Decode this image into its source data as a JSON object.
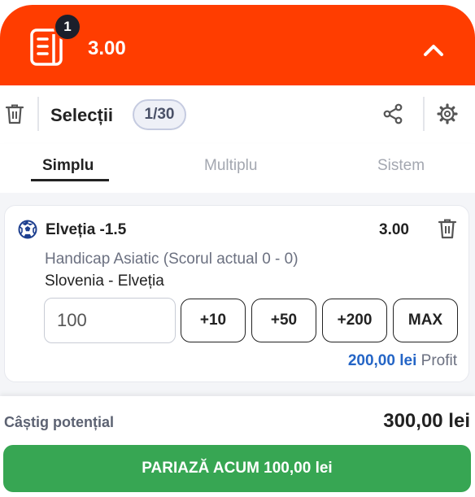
{
  "header": {
    "badge_count": "1",
    "total_odds": "3.00",
    "colors": {
      "background": "#ff3d00",
      "badge": "#1c1f2b"
    },
    "icons": {
      "betslip": "betslip-icon",
      "collapse": "chevron-up-icon"
    }
  },
  "toolbar": {
    "title": "Selecții",
    "count": "1/30",
    "icons": {
      "delete_all": "trash-icon",
      "share": "share-icon",
      "settings": "gear-icon"
    }
  },
  "tabs": [
    {
      "label": "Simplu",
      "active": true
    },
    {
      "label": "Multiplu",
      "active": false
    },
    {
      "label": "Sistem",
      "active": false
    }
  ],
  "selection": {
    "sport_icon": "soccer-ball-icon",
    "name": "Elveția -1.5",
    "odds": "3.00",
    "market": "Handicap Asiatic (Scorul actual 0 - 0)",
    "event": "Slovenia - Elveția",
    "stake": {
      "value": "100",
      "quick_amounts": [
        "+10",
        "+50",
        "+200",
        "MAX"
      ]
    },
    "profit": {
      "amount": "200,00 lei",
      "label": "Profit"
    }
  },
  "footer": {
    "potential_win_label": "Câștig potențial",
    "potential_win_value": "300,00 lei",
    "place_bet_label": "PARIAZĂ ACUM 100,00 lei",
    "colors": {
      "place_button": "#37a653",
      "profit_text": "#2465c6"
    }
  }
}
